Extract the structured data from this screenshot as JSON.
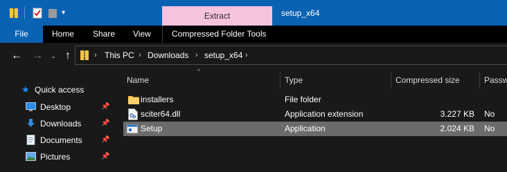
{
  "colors": {
    "titlebar": "#0a62b3",
    "context_tab": "#f6c3de",
    "background": "#191919",
    "selected_row": "#6b6b6b",
    "accent": "#1e90ff"
  },
  "titlebar": {
    "context_tab_label": "Extract",
    "window_title": "setup_x64"
  },
  "ribbon": {
    "file": "File",
    "home": "Home",
    "share": "Share",
    "view": "View",
    "compressed_tools": "Compressed Folder Tools"
  },
  "breadcrumb": [
    "This PC",
    "Downloads",
    "setup_x64"
  ],
  "columns": {
    "name": "Name",
    "type": "Type",
    "compressed_size": "Compressed size",
    "password": "Passw"
  },
  "navpane": {
    "quick_access": "Quick access",
    "items": [
      {
        "label": "Desktop",
        "icon": "desktop-icon"
      },
      {
        "label": "Downloads",
        "icon": "downloads-icon"
      },
      {
        "label": "Documents",
        "icon": "documents-icon"
      },
      {
        "label": "Pictures",
        "icon": "pictures-icon"
      }
    ]
  },
  "files": [
    {
      "name": "installers",
      "type": "File folder",
      "size": "",
      "password": "",
      "icon": "folder-icon"
    },
    {
      "name": "sciter64.dll",
      "type": "Application extension",
      "size": "3.227 KB",
      "password": "No",
      "icon": "dll-file-icon"
    },
    {
      "name": "Setup",
      "type": "Application",
      "size": "2.024 KB",
      "password": "No",
      "icon": "application-icon",
      "selected": true
    }
  ]
}
